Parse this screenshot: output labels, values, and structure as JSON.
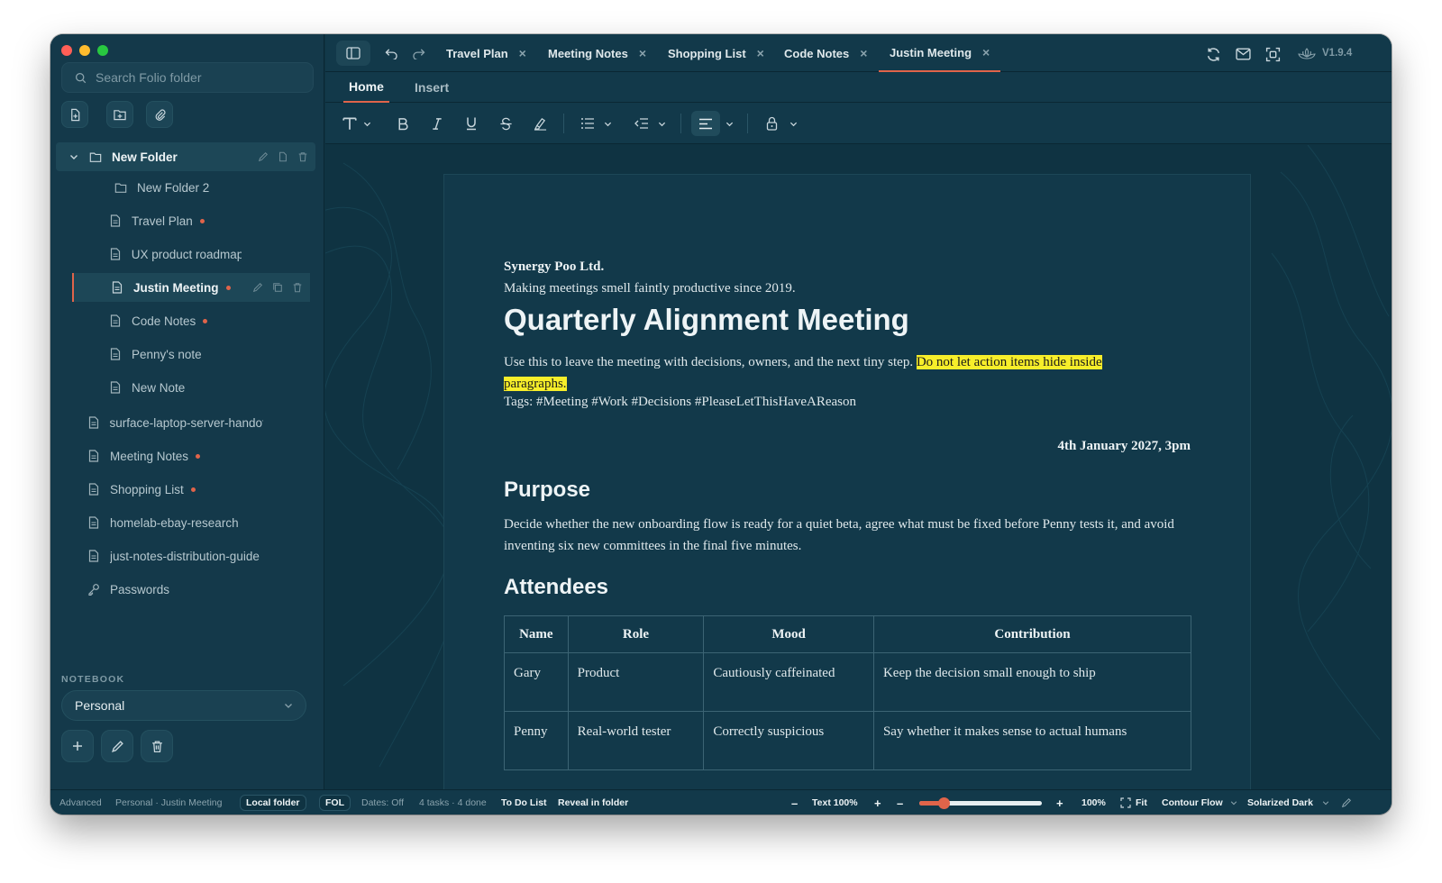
{
  "sidebar": {
    "search_placeholder": "Search Folio folder",
    "tree": [
      {
        "label": "New Folder",
        "type": "folder",
        "expanded": true
      },
      {
        "label": "New Folder 2",
        "type": "folder"
      },
      {
        "label": "Travel Plan",
        "type": "note",
        "modified": true
      },
      {
        "label": "UX product roadmap",
        "type": "note"
      },
      {
        "label": "Justin Meeting",
        "type": "note",
        "modified": true,
        "selected": true
      },
      {
        "label": "Code Notes",
        "type": "note",
        "modified": true
      },
      {
        "label": "Penny's note",
        "type": "note"
      },
      {
        "label": "New Note",
        "type": "note"
      },
      {
        "label": "surface-laptop-server-handoff",
        "type": "note"
      },
      {
        "label": "Meeting Notes",
        "type": "note",
        "modified": true
      },
      {
        "label": "Shopping List",
        "type": "note",
        "modified": true
      },
      {
        "label": "homelab-ebay-research",
        "type": "note"
      },
      {
        "label": "just-notes-distribution-guide",
        "type": "note"
      },
      {
        "label": "Passwords",
        "type": "key"
      }
    ],
    "notebook_label": "NOTEBOOK",
    "notebook_value": "Personal"
  },
  "tabs": [
    {
      "label": "Travel Plan"
    },
    {
      "label": "Meeting Notes"
    },
    {
      "label": "Shopping List"
    },
    {
      "label": "Code Notes"
    },
    {
      "label": "Justin Meeting",
      "active": true
    }
  ],
  "version": "V1.9.4",
  "subnav": {
    "home": "Home",
    "insert": "Insert"
  },
  "doc": {
    "company": "Synergy Poo Ltd.",
    "tagline": "Making meetings smell faintly productive since 2019.",
    "title": "Quarterly Alignment Meeting",
    "intro": "Use this to leave the meeting with decisions, owners, and the next tiny step. ",
    "intro_highlight": "Do not let action items hide inside paragraphs.",
    "tags": "Tags: #Meeting #Work #Decisions #PleaseLetThisHaveAReason",
    "date": "4th January 2027, 3pm",
    "purpose_heading": "Purpose",
    "purpose_body": "Decide whether the new onboarding flow is ready for a quiet beta, agree what must be fixed before Penny tests it, and avoid inventing six new committees in the final five minutes.",
    "attendees_heading": "Attendees",
    "table": {
      "headers": [
        "Name",
        "Role",
        "Mood",
        "Contribution"
      ],
      "rows": [
        [
          "Gary",
          "Product",
          "Cautiously caffeinated",
          "Keep the decision small enough to ship"
        ],
        [
          "Penny",
          "Real-world tester",
          "Correctly suspicious",
          "Say whether it makes sense to actual humans"
        ]
      ]
    }
  },
  "status": {
    "advanced": "Advanced",
    "crumb": "Personal · Justin Meeting",
    "local": "Local folder",
    "fol": "FOL",
    "dates": "Dates: Off",
    "tasks": "4 tasks · 4 done",
    "todo": "To Do List",
    "reveal": "Reveal in folder",
    "text_zoom": "Text 100%",
    "zoom": "100%",
    "fit": "Fit",
    "zoom_slider_fraction": 0.2,
    "flow": "Contour Flow",
    "theme": "Solarized Dark"
  },
  "colors": {
    "accent": "#e0644a",
    "highlight": "#f7ee2a",
    "background": "#0f3342"
  }
}
